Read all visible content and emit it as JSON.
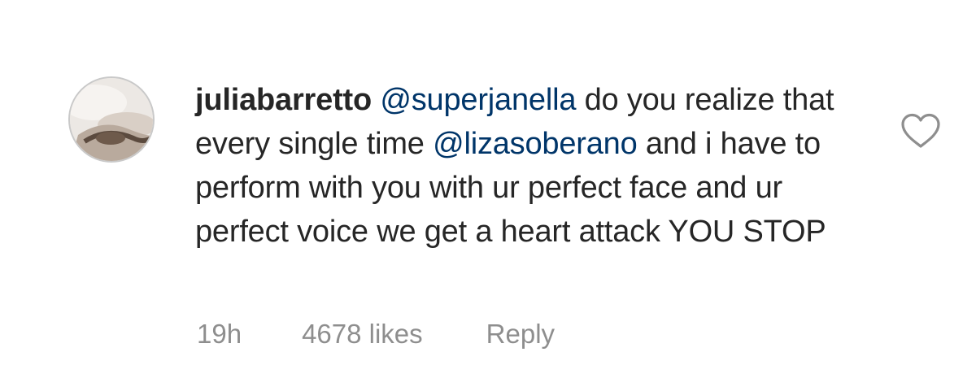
{
  "comment": {
    "username": "juliabarretto",
    "text_parts": [
      {
        "type": "mention",
        "value": "@superjanella"
      },
      {
        "type": "text",
        "value": " do you realize that every single time "
      },
      {
        "type": "mention",
        "value": "@lizasoberano"
      },
      {
        "type": "text",
        "value": " and i have to perform with you with ur perfect face and ur perfect voice we get a heart attack YOU STOP"
      }
    ],
    "time": "19h",
    "likes": "4678 likes",
    "reply_label": "Reply",
    "like_icon": "heart-outline-icon"
  },
  "colors": {
    "text": "#262626",
    "mention": "#003569",
    "meta": "#8e8e8e"
  }
}
